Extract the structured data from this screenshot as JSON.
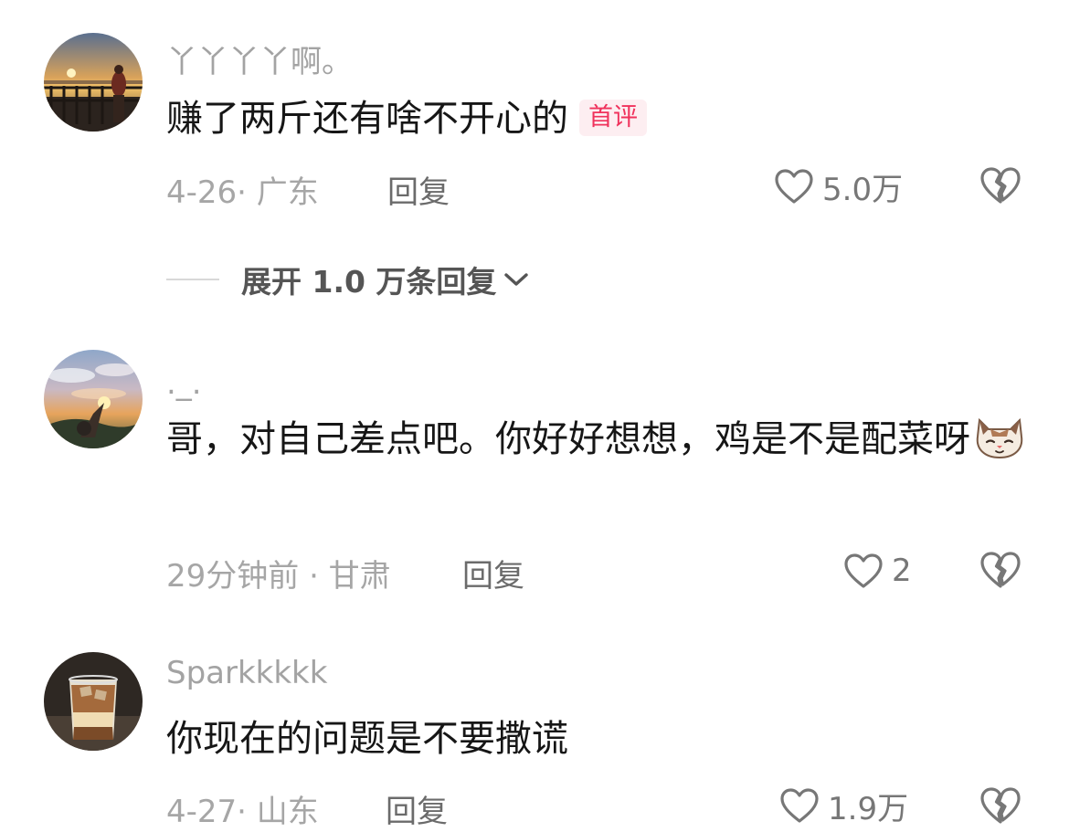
{
  "comments": [
    {
      "username": "丫丫丫丫啊。",
      "content": "赚了两斤还有啥不开心的",
      "badge": "首评",
      "date_location": "4-26· 广东",
      "reply_label": "回复",
      "likes": "5.0万"
    },
    {
      "username": "._.",
      "content": "哥，对自己差点吧。你好好想想，鸡是不是配菜呀",
      "emoji": "cat-face-emoji",
      "date_location": "29分钟前 · 甘肃",
      "reply_label": "回复",
      "likes": "2"
    },
    {
      "username": "Sparkkkkk",
      "content": "你现在的问题是不要撒谎",
      "date_location": "4-27· 山东",
      "reply_label": "回复",
      "likes": "1.9万"
    }
  ],
  "expand_replies": {
    "label": "展开 1.0 万条回复"
  },
  "icons": {
    "like": "heart-outline-icon",
    "dislike": "broken-heart-icon",
    "expand": "chevron-down-icon"
  },
  "colors": {
    "badge_text": "#f0325c",
    "badge_bg": "#fdeef1",
    "meta_text": "#a6a6a6"
  }
}
